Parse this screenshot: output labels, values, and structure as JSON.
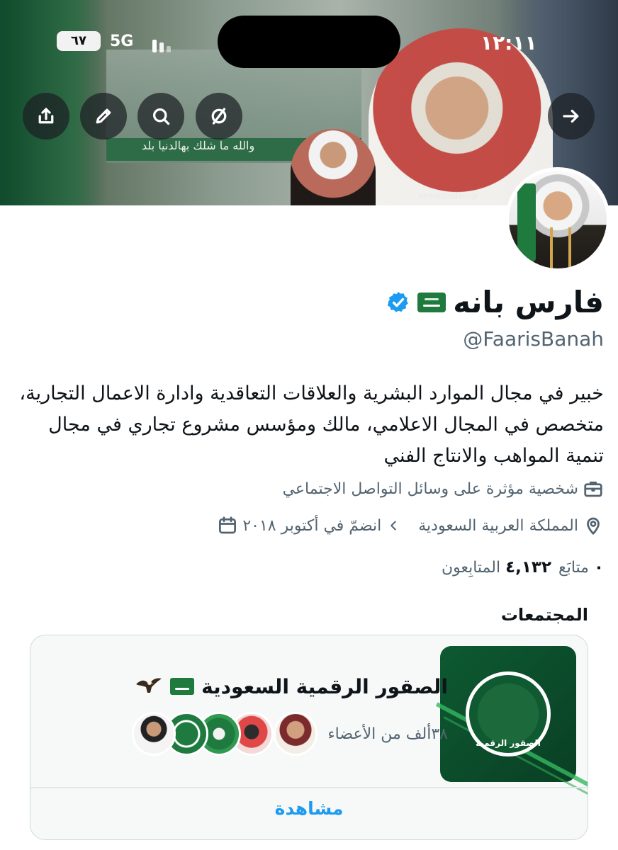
{
  "status_bar": {
    "time": "١٢:١١",
    "network": "5G",
    "battery": "٦٧"
  },
  "header": {
    "banner_caption": "والله ما شلك بهالدنيا بلد",
    "banner_watermark": "@ahmadrodain",
    "buttons": {
      "back_icon": "arrow-right",
      "mute_icon": "circle-slash",
      "search_icon": "search",
      "edit_icon": "pencil",
      "share_icon": "share"
    }
  },
  "profile": {
    "name": "فارس بانه",
    "handle": "@FaarisBanah",
    "bio": "خبير في مجال الموارد البشرية والعلاقات التعاقدية وادارة الاعمال التجارية، متخصص في المجال الاعلامي، مالك ومؤسس مشروع تجاري في مجال تنمية المواهب والانتاج الفني",
    "category": "شخصية مؤثرة على وسائل التواصل الاجتماعي",
    "location": "المملكة العربية السعودية",
    "joined": "انضمّ في أكتوبر ٢٠١٨",
    "following_label": "متابَع",
    "following_count": "٠",
    "followers_count": "٤,١٣٢",
    "followers_label": "المتابِعون"
  },
  "communities": {
    "section_title": "المجتمعات",
    "card": {
      "title": "الصقور الرقمية السعودية",
      "members": "٣٨ألف من الأعضاء",
      "image_caption": "الصقور الرقمية",
      "view_label": "مشاهدة"
    }
  },
  "colors": {
    "accent": "#1d9bf0",
    "text_primary": "#0f1419",
    "text_secondary": "#536471",
    "flag_green": "#1f7a3d"
  }
}
